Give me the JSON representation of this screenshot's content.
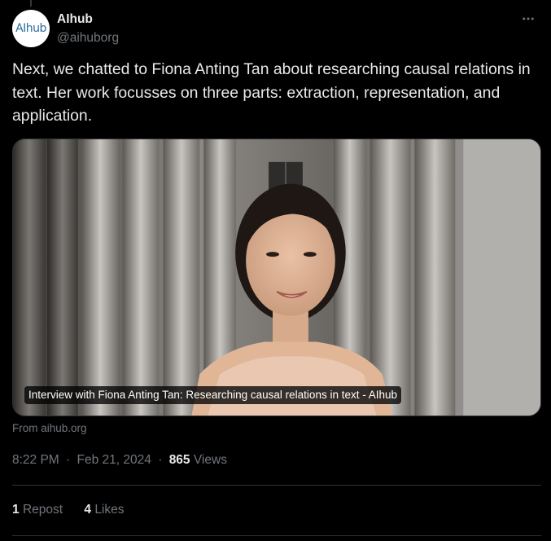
{
  "author": {
    "display_name": "AIhub",
    "handle": "@aihuborg",
    "avatar_text": "AIhub"
  },
  "tweet": {
    "text": "Next, we chatted to Fiona Anting Tan about researching causal relations in text. Her work focusses on three parts: extraction, representation, and application."
  },
  "card": {
    "title": "Interview with Fiona Anting Tan: Researching causal relations in text - AIhub",
    "source": "From aihub.org"
  },
  "meta": {
    "time": "8:22 PM",
    "date": "Feb 21, 2024",
    "separator": "·",
    "views_count": "865",
    "views_label": "Views"
  },
  "stats": {
    "reposts_count": "1",
    "reposts_label": "Repost",
    "likes_count": "4",
    "likes_label": "Likes"
  },
  "icons": {
    "more": "more-horizontal-icon"
  },
  "colors": {
    "background": "#000000",
    "text_primary": "#e7e9ea",
    "text_secondary": "#71767b",
    "border": "#2f3336",
    "avatar_logo": "#2b6f9c"
  }
}
